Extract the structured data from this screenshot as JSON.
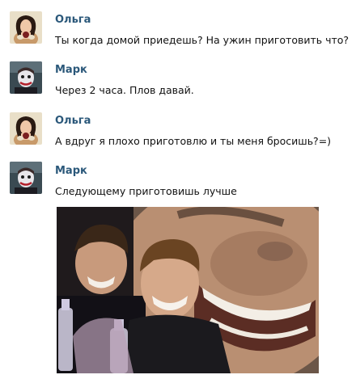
{
  "messages": [
    {
      "author": "Ольга",
      "text": "Ты когда домой приедешь? На ужин приготовить что?",
      "avatar_icon": "olga-avatar-icon"
    },
    {
      "author": "Марк",
      "text": "Через 2 часа. Плов давай.",
      "avatar_icon": "mark-avatar-icon"
    },
    {
      "author": "Ольга",
      "text": "А вдруг я плохо приготовлю и ты меня бросишь?=)",
      "avatar_icon": "olga-avatar-icon"
    },
    {
      "author": "Марк",
      "text": "Следующему приготовишь лучше",
      "avatar_icon": "mark-avatar-icon"
    }
  ],
  "colors": {
    "author_name": "#2b587a",
    "message_text": "#111111",
    "background": "#ffffff"
  }
}
